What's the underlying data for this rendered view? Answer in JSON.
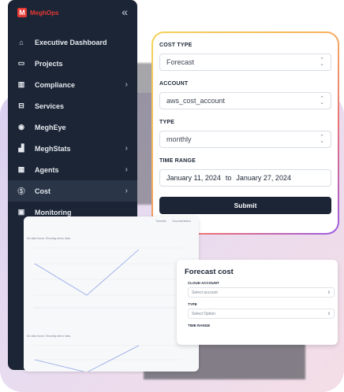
{
  "brand": {
    "name": "MeghOps"
  },
  "sidebar": {
    "items": [
      {
        "label": "Executive Dashboard",
        "icon": "home-icon",
        "chevron": false,
        "active": false
      },
      {
        "label": "Projects",
        "icon": "folder-icon",
        "chevron": false,
        "active": false
      },
      {
        "label": "Compliance",
        "icon": "columns-icon",
        "chevron": true,
        "active": false
      },
      {
        "label": "Services",
        "icon": "drive-icon",
        "chevron": false,
        "active": false
      },
      {
        "label": "MeghEye",
        "icon": "eye-icon",
        "chevron": false,
        "active": false
      },
      {
        "label": "MeghStats",
        "icon": "bar-chart-icon",
        "chevron": true,
        "active": false
      },
      {
        "label": "Agents",
        "icon": "grid-icon",
        "chevron": true,
        "active": false
      },
      {
        "label": "Cost",
        "icon": "dollar-icon",
        "chevron": true,
        "active": true
      },
      {
        "label": "Monitoring",
        "icon": "monitor-icon",
        "chevron": false,
        "active": false
      }
    ]
  },
  "form": {
    "cost_type_label": "COST TYPE",
    "cost_type_value": "Forecast",
    "account_label": "ACCOUNT",
    "account_value": "aws_cost_account",
    "type_label": "TYPE",
    "type_value": "monthly",
    "time_range_label": "TIME RANGE",
    "date_start": "January 11, 2024",
    "date_to": "to",
    "date_end": "January 27, 2024",
    "submit_label": "Submit"
  },
  "chart_panel": {
    "tabs": [
      "Tutorials",
      "Documentation"
    ],
    "note_1": "No data found. Showing demo data.",
    "note_2": "No data found. Showing demo data."
  },
  "forecast": {
    "title": "Forecast cost",
    "cloud_account_label": "CLOUD ACCOUNT",
    "cloud_account_placeholder": "Select account",
    "type_label": "TYPE",
    "type_placeholder": "Select Option",
    "time_range_label": "TIME RANGE"
  },
  "colors": {
    "sidebar_bg": "#1b2535",
    "brand_red": "#e53935",
    "line_blue": "#8fa6e6"
  }
}
